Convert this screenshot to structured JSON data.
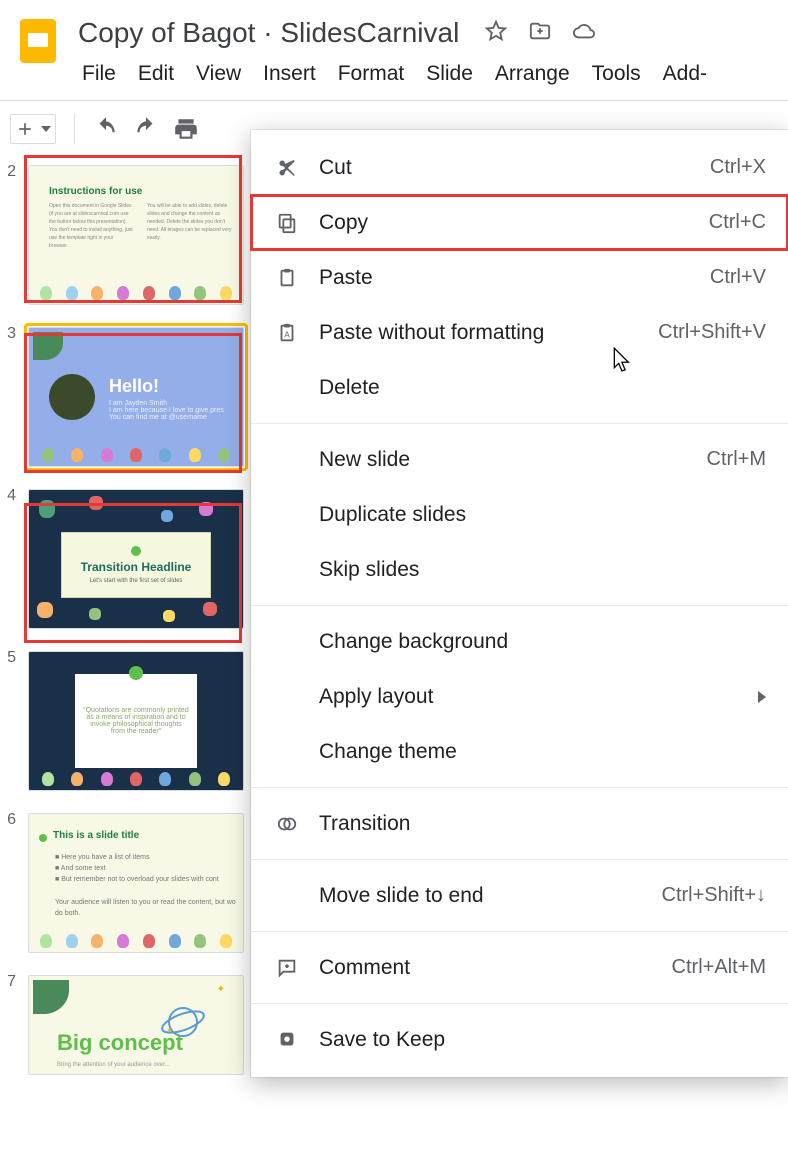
{
  "doc_title": "Copy of Bagot · SlidesCarnival",
  "menu": {
    "file": "File",
    "edit": "Edit",
    "view": "View",
    "insert": "Insert",
    "format": "Format",
    "slide": "Slide",
    "arrange": "Arrange",
    "tools": "Tools",
    "addons": "Add-"
  },
  "context_menu": {
    "cut": {
      "label": "Cut",
      "shortcut": "Ctrl+X"
    },
    "copy": {
      "label": "Copy",
      "shortcut": "Ctrl+C"
    },
    "paste": {
      "label": "Paste",
      "shortcut": "Ctrl+V"
    },
    "paste_plain": {
      "label": "Paste without formatting",
      "shortcut": "Ctrl+Shift+V"
    },
    "delete": {
      "label": "Delete"
    },
    "new_slide": {
      "label": "New slide",
      "shortcut": "Ctrl+M"
    },
    "duplicate": {
      "label": "Duplicate slides"
    },
    "skip": {
      "label": "Skip slides"
    },
    "change_bg": {
      "label": "Change background"
    },
    "apply_layout": {
      "label": "Apply layout"
    },
    "change_theme": {
      "label": "Change theme"
    },
    "transition": {
      "label": "Transition"
    },
    "move_end": {
      "label": "Move slide to end",
      "shortcut": "Ctrl+Shift+↓"
    },
    "comment": {
      "label": "Comment",
      "shortcut": "Ctrl+Alt+M"
    },
    "save_keep": {
      "label": "Save to Keep"
    }
  },
  "slides": {
    "s2": {
      "num": "2",
      "title": "Instructions for use"
    },
    "s3": {
      "num": "3",
      "hello": "Hello!",
      "name": "I am Jayden Smith",
      "sub": "I am here because I love to give pres",
      "sub2": "You can find me at @username"
    },
    "s4": {
      "num": "4",
      "headline": "Transition Headline",
      "sub": "Let's start with the first set of slides"
    },
    "s5": {
      "num": "5",
      "quote": "“Quotations are commonly printed as a means of inspiration and to invoke philosophical thoughts from the reader”"
    },
    "s6": {
      "num": "6",
      "title": "This is a slide title",
      "b1": "Here you have a list of items",
      "b2": "And some text",
      "b3": "But remember not to overload your slides with cont",
      "p1": "Your audience will listen to you or read the content, but wo",
      "p2": "do both."
    },
    "s7": {
      "num": "7",
      "title": "Big concept",
      "sub": "Bring the attention of your audience over..."
    }
  }
}
